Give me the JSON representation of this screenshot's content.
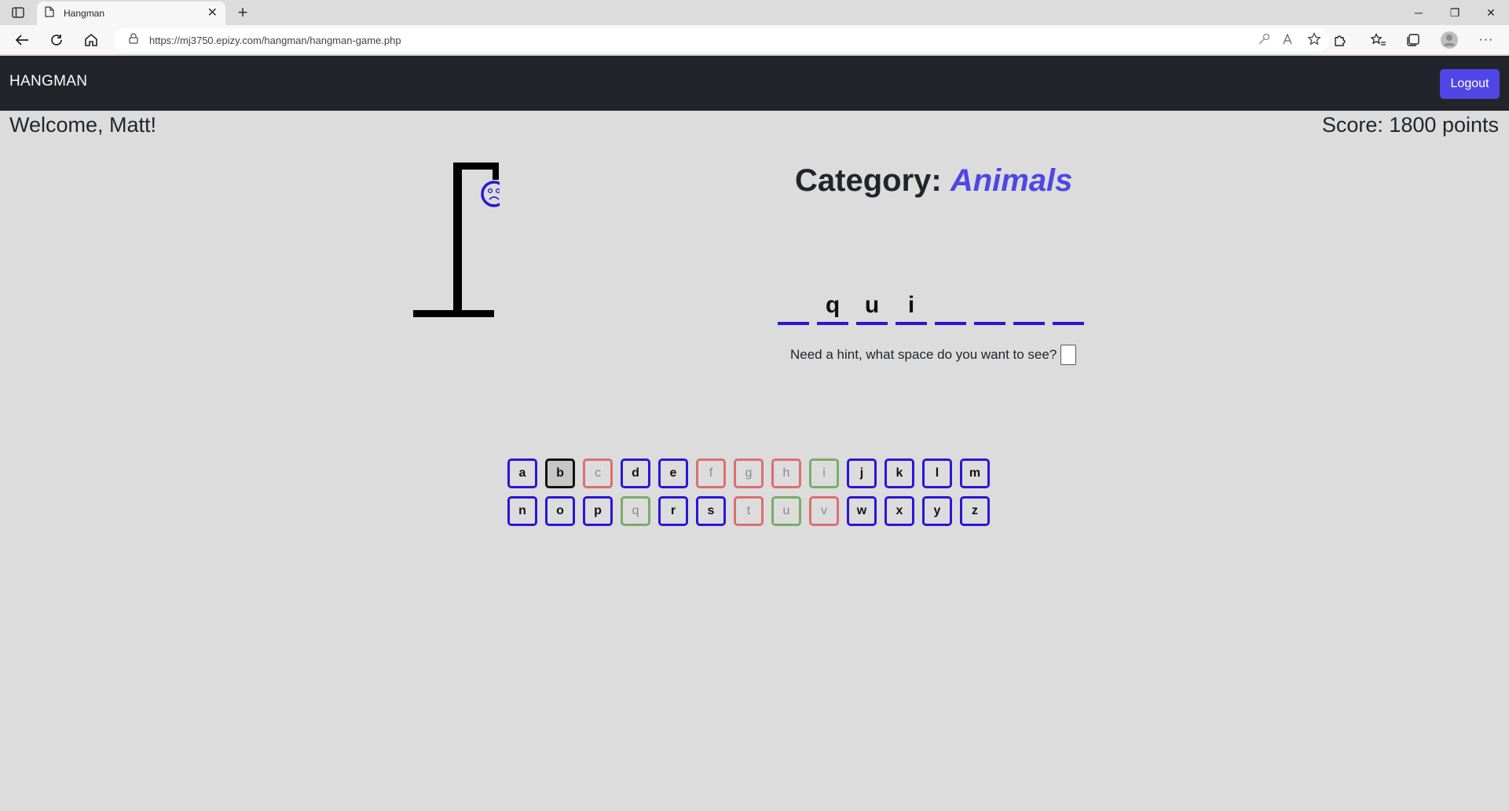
{
  "browser": {
    "tab_title": "Hangman",
    "url": "https://mj3750.epizy.com/hangman/hangman-game.php"
  },
  "navbar": {
    "brand": "HANGMAN",
    "logout_label": "Logout"
  },
  "header": {
    "welcome": "Welcome, Matt!",
    "score": "Score: 1800 points"
  },
  "game": {
    "category_label": "Category: ",
    "category_value": "Animals",
    "word_slots": [
      "",
      "q",
      "u",
      "i",
      "",
      "",
      "",
      ""
    ],
    "hint_label": "Need a hint, what space do you want to see?",
    "hint_value": ""
  },
  "keyboard": {
    "rows": [
      [
        {
          "letter": "a",
          "state": "available"
        },
        {
          "letter": "b",
          "state": "hover"
        },
        {
          "letter": "c",
          "state": "wrong"
        },
        {
          "letter": "d",
          "state": "available"
        },
        {
          "letter": "e",
          "state": "available"
        },
        {
          "letter": "f",
          "state": "wrong"
        },
        {
          "letter": "g",
          "state": "wrong"
        },
        {
          "letter": "h",
          "state": "wrong"
        },
        {
          "letter": "i",
          "state": "correct"
        },
        {
          "letter": "j",
          "state": "available"
        },
        {
          "letter": "k",
          "state": "available"
        },
        {
          "letter": "l",
          "state": "available"
        },
        {
          "letter": "m",
          "state": "available"
        }
      ],
      [
        {
          "letter": "n",
          "state": "available"
        },
        {
          "letter": "o",
          "state": "available"
        },
        {
          "letter": "p",
          "state": "available"
        },
        {
          "letter": "q",
          "state": "correct"
        },
        {
          "letter": "r",
          "state": "available"
        },
        {
          "letter": "s",
          "state": "available"
        },
        {
          "letter": "t",
          "state": "wrong"
        },
        {
          "letter": "u",
          "state": "correct"
        },
        {
          "letter": "v",
          "state": "wrong"
        },
        {
          "letter": "w",
          "state": "available"
        },
        {
          "letter": "x",
          "state": "available"
        },
        {
          "letter": "y",
          "state": "available"
        },
        {
          "letter": "z",
          "state": "available"
        }
      ]
    ]
  },
  "colors": {
    "navbar_bg": "#212529",
    "accent": "#5046e5",
    "slot_line": "#2a16d6",
    "wrong": "#dc6f6f",
    "correct": "#7aac6a"
  }
}
